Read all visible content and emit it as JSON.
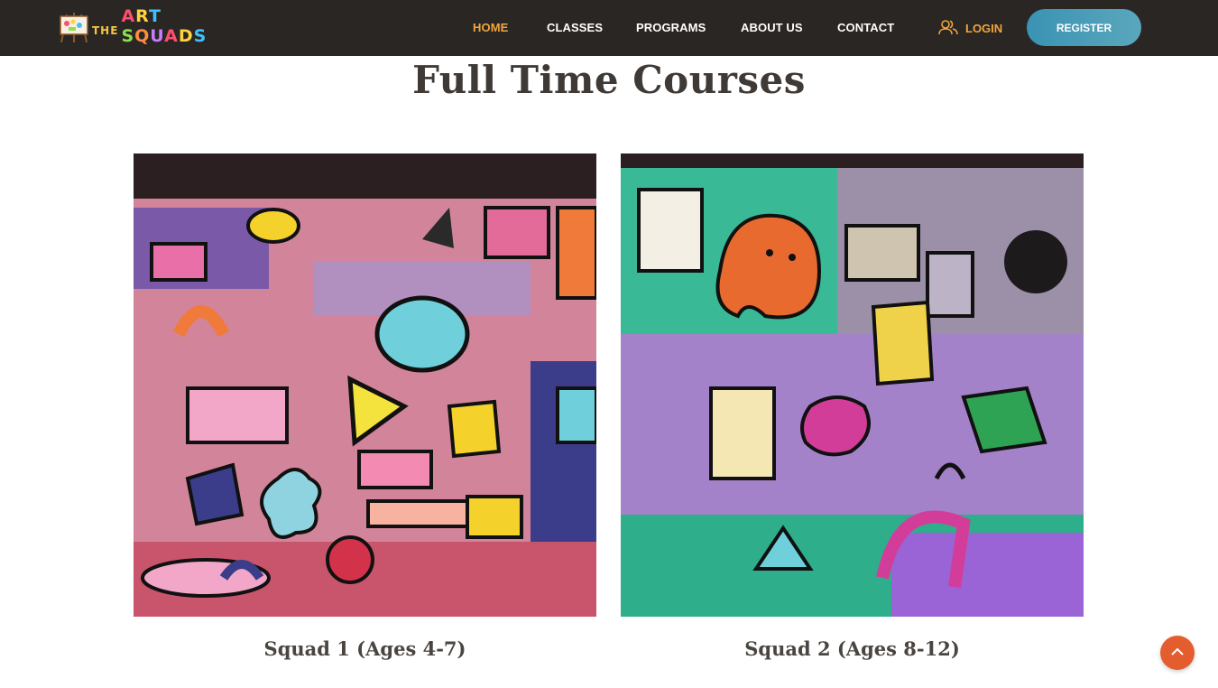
{
  "nav": {
    "logo_the": "THE",
    "logo_art": "ART SQUADS",
    "links": [
      "HOME",
      "CLASSES",
      "PROGRAMS",
      "ABOUT US",
      "CONTACT"
    ],
    "login": "LOGIN",
    "register": "REGISTER"
  },
  "main": {
    "title": "Full Time Courses",
    "courses": [
      {
        "title": "Squad 1 (Ages 4-7)"
      },
      {
        "title": "Squad 2 (Ages 8-12)"
      }
    ]
  },
  "colors": {
    "navbar": "#2a2623",
    "accent": "#f0a640",
    "register": "#3a93b3",
    "to_top": "#e35d2f",
    "heading": "#3f3a35"
  }
}
